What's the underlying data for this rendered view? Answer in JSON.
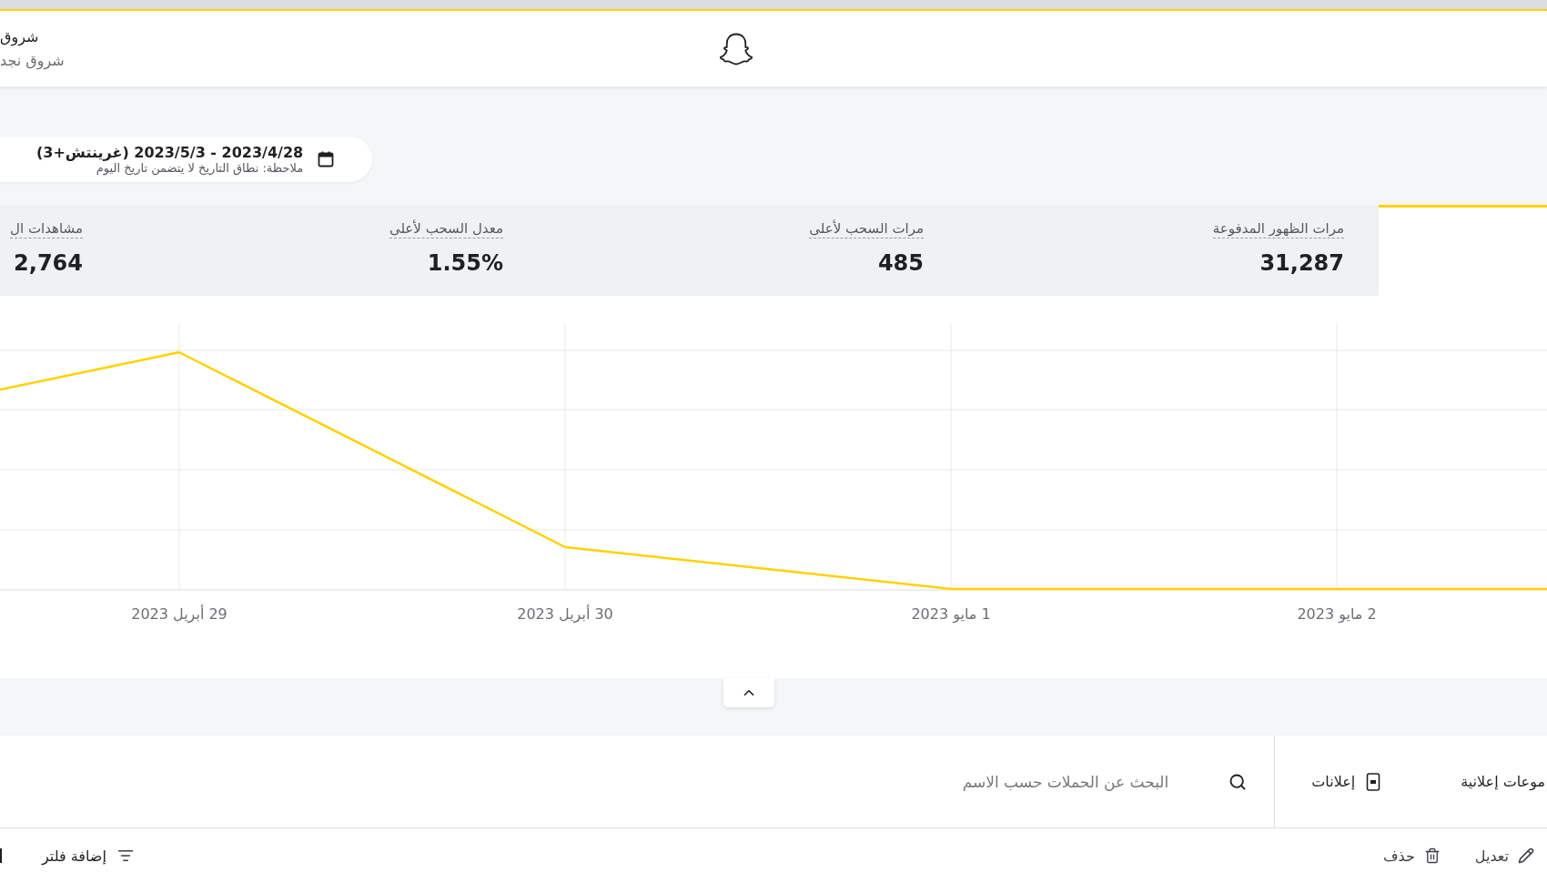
{
  "header": {
    "account_name": "شروق",
    "account_subtitle": "شروق نجد"
  },
  "date_range": {
    "range": "2023/4/28 - 2023/5/3 (غرينتش+3)",
    "note": "ملاحظة: نطاق التاريخ لا يتضمن تاريخ اليوم"
  },
  "metrics": [
    {
      "selected": true
    },
    {
      "label": "مرات الظهور المدفوعة",
      "value": "31,287",
      "selected": false
    },
    {
      "label": "مرات السحب لأعلى",
      "value": "485",
      "selected": false
    },
    {
      "label": "معدل السحب لأعلى",
      "value": "1.55%",
      "selected": false
    },
    {
      "label": "مشاهدات ال",
      "value": "2,764",
      "selected": false
    }
  ],
  "chart": {
    "x_labels": [
      "2 مايو 2023",
      "1 مايو 2023",
      "30 أبريل 2023",
      "29 أبريل 2023"
    ]
  },
  "panel_toggle": {
    "expanded": true
  },
  "toolbar": {
    "tabs": [
      {
        "kind": "ad_sets",
        "label": "موعات إعلانية",
        "selected": false
      },
      {
        "kind": "ads",
        "label": "إعلانات",
        "selected": false
      }
    ],
    "search": {
      "placeholder": "البحث عن الحملات حسب الاسم"
    }
  },
  "actions": [
    {
      "kind": "edit",
      "label": "تعديل"
    },
    {
      "kind": "delete",
      "label": "حذف"
    }
  ],
  "filter_button": {
    "label": "إضافة فلتر"
  }
}
